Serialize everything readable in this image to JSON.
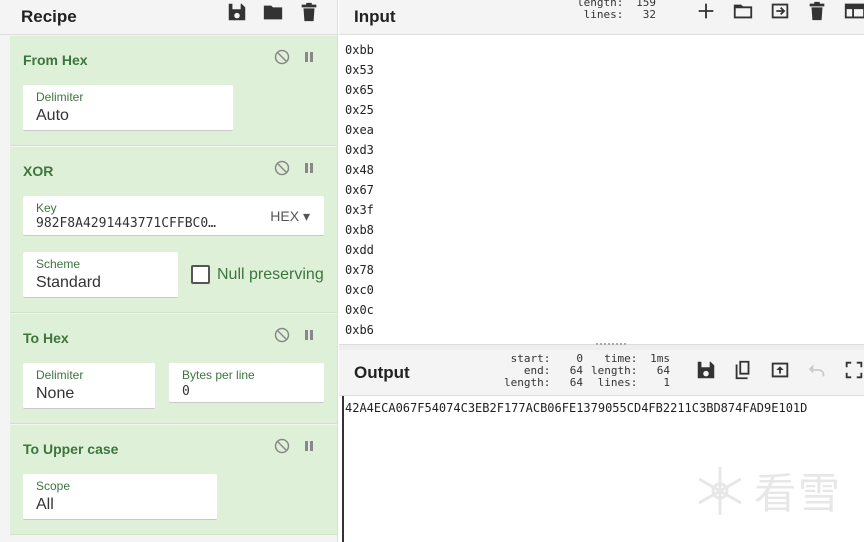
{
  "recipe": {
    "title": "Recipe",
    "operations": [
      {
        "name": "From Hex",
        "fields": [
          {
            "label": "Delimiter",
            "value": "Auto"
          }
        ]
      },
      {
        "name": "XOR",
        "key_label": "Key",
        "key_value": "982F8A4291443771CFFBC0…",
        "key_format": "HEX ▾",
        "scheme_label": "Scheme",
        "scheme_value": "Standard",
        "null_preserving_label": "Null preserving"
      },
      {
        "name": "To Hex",
        "delimiter_label": "Delimiter",
        "delimiter_value": "None",
        "bpl_label": "Bytes per line",
        "bpl_value": "0"
      },
      {
        "name": "To Upper case",
        "scope_label": "Scope",
        "scope_value": "All"
      }
    ]
  },
  "input": {
    "title": "Input",
    "stats": {
      "length_label": "length:",
      "length_value": "159",
      "lines_label": "lines:",
      "lines_value": "32"
    },
    "lines": [
      "0xbb",
      "0x53",
      "0x65",
      "0x25",
      "0xea",
      "0xd3",
      "0x48",
      "0x67",
      "0x3f",
      "0xb8",
      "0xdd",
      "0x78",
      "0xc0",
      "0x0c",
      "0xb6"
    ]
  },
  "output": {
    "title": "Output",
    "stats": {
      "start_label": "start:",
      "start_value": "0",
      "end_label": "end:",
      "end_value": "64",
      "length_label": "length:",
      "length_value": "64",
      "time_label": "time:",
      "time_value": "1ms",
      "olength_label": "length:",
      "olength_value": "64",
      "lines_label": "lines:",
      "lines_value": "1"
    },
    "text": "42A4ECA067F54074C3EB2F177ACB06FE1379055CD4FB2211C3BD874FAD9E101D"
  },
  "watermark": {
    "text": "看雪"
  }
}
